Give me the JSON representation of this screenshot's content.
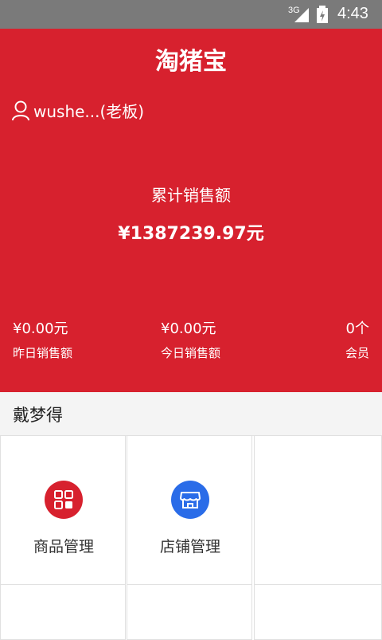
{
  "status_bar": {
    "network": "3G",
    "time": "4:43"
  },
  "header": {
    "title": "淘猪宝"
  },
  "user": {
    "name": "wushe...(老板)",
    "icon": "user-icon"
  },
  "sales": {
    "total_label": "累计销售额",
    "total_value": "¥1387239.97元",
    "stats": [
      {
        "value": "¥0.00元",
        "label": "昨日销售额"
      },
      {
        "value": "¥0.00元",
        "label": "今日销售额"
      },
      {
        "value": "0个",
        "label": "会员"
      }
    ]
  },
  "store": {
    "name": "戴梦得"
  },
  "grid": {
    "items": [
      {
        "label": "商品管理",
        "icon": "product-grid-icon",
        "color": "#d7212e"
      },
      {
        "label": "店铺管理",
        "icon": "store-icon",
        "color": "#2a6ce8"
      }
    ]
  },
  "colors": {
    "primary": "#d7212e",
    "status_bar": "#7a7a7a"
  }
}
